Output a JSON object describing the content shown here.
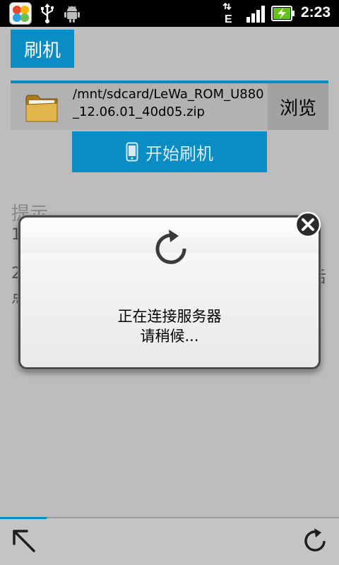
{
  "status_bar": {
    "time": "2:23",
    "network_type": "E",
    "icons": [
      "app-flower-icon",
      "usb-icon",
      "android-debug-icon",
      "network-e-icon",
      "signal-icon",
      "battery-charging-icon"
    ]
  },
  "header": {
    "title": "刷机"
  },
  "file": {
    "path": "/mnt/sdcard/LeWa_ROM_U880_12.06.01_40d05.zip",
    "browse_label": "浏览"
  },
  "actions": {
    "start_flash_label": "开始刷机"
  },
  "hints": {
    "title": "提示",
    "item1_prefix": "1",
    "item2_prefix": "2",
    "item2_line2_start": "点",
    "item2_line1_end": "后"
  },
  "dialog": {
    "message_line1": "正在连接服务器",
    "message_line2": "请稍候..."
  },
  "colors": {
    "accent": "#0a8cc4",
    "app_bg": "#bdbdbd",
    "status_bar": "#000000"
  }
}
